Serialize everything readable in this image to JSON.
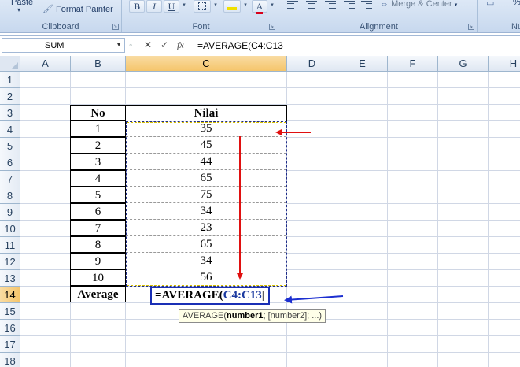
{
  "ribbon": {
    "clipboard": {
      "paste_label": "Paste",
      "format_painter_label": "Format Painter",
      "group_label": "Clipboard"
    },
    "font": {
      "bold": "B",
      "italic": "I",
      "underline": "U",
      "font_color_letter": "A",
      "group_label": "Font"
    },
    "alignment": {
      "merge_center_label": "Merge & Center",
      "group_label": "Alignment"
    },
    "number": {
      "group_label": "Nu",
      "percent": "%"
    }
  },
  "formula_bar": {
    "name_box_value": "SUM",
    "cancel_symbol": "✕",
    "enter_symbol": "✓",
    "fx_symbol": "fx",
    "formula": "=AVERAGE(C4:C13"
  },
  "sheet": {
    "columns": [
      "A",
      "B",
      "C",
      "D",
      "E",
      "F",
      "G",
      "H"
    ],
    "rows": [
      "1",
      "2",
      "3",
      "4",
      "5",
      "6",
      "7",
      "8",
      "9",
      "10",
      "11",
      "12",
      "13",
      "14",
      "15",
      "16",
      "17",
      "18"
    ],
    "selected_column": "C",
    "selected_row": "14",
    "table": {
      "header_no": "No",
      "header_nilai": "Nilai",
      "rows": [
        {
          "no": "1",
          "nilai": "35"
        },
        {
          "no": "2",
          "nilai": "45"
        },
        {
          "no": "3",
          "nilai": "44"
        },
        {
          "no": "4",
          "nilai": "65"
        },
        {
          "no": "5",
          "nilai": "75"
        },
        {
          "no": "6",
          "nilai": "34"
        },
        {
          "no": "7",
          "nilai": "23"
        },
        {
          "no": "8",
          "nilai": "65"
        },
        {
          "no": "9",
          "nilai": "34"
        },
        {
          "no": "10",
          "nilai": "56"
        }
      ],
      "average_label": "Average"
    },
    "edit_cell": {
      "prefix": "=AVERAGE(",
      "ref": "C4:C13"
    },
    "tooltip": {
      "fn": "AVERAGE(",
      "arg1": "number1",
      "rest": "; [number2]; ...)"
    }
  },
  "annotations": {
    "arrow_color": "#e01010",
    "blue_arrow_color": "#1c2fd0"
  }
}
